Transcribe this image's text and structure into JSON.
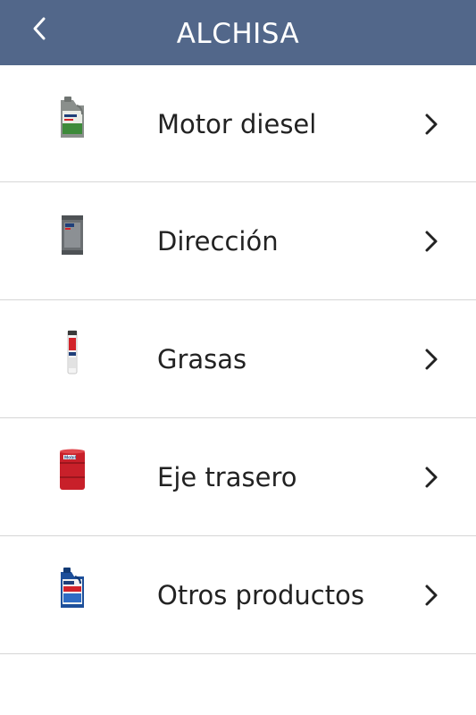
{
  "header": {
    "title": "ALCHISA",
    "background": "#52678a"
  },
  "list": {
    "items": [
      {
        "label": "Motor diesel",
        "icon": "motor-oil-jug-icon"
      },
      {
        "label": "Dirección",
        "icon": "oil-can-icon"
      },
      {
        "label": "Grasas",
        "icon": "grease-cartridge-icon"
      },
      {
        "label": "Eje trasero",
        "icon": "oil-drum-icon"
      },
      {
        "label": "Otros productos",
        "icon": "coolant-jug-icon"
      }
    ]
  },
  "colors": {
    "text": "#222222",
    "divider": "#d6d6d6",
    "brand_red": "#d2232a"
  }
}
